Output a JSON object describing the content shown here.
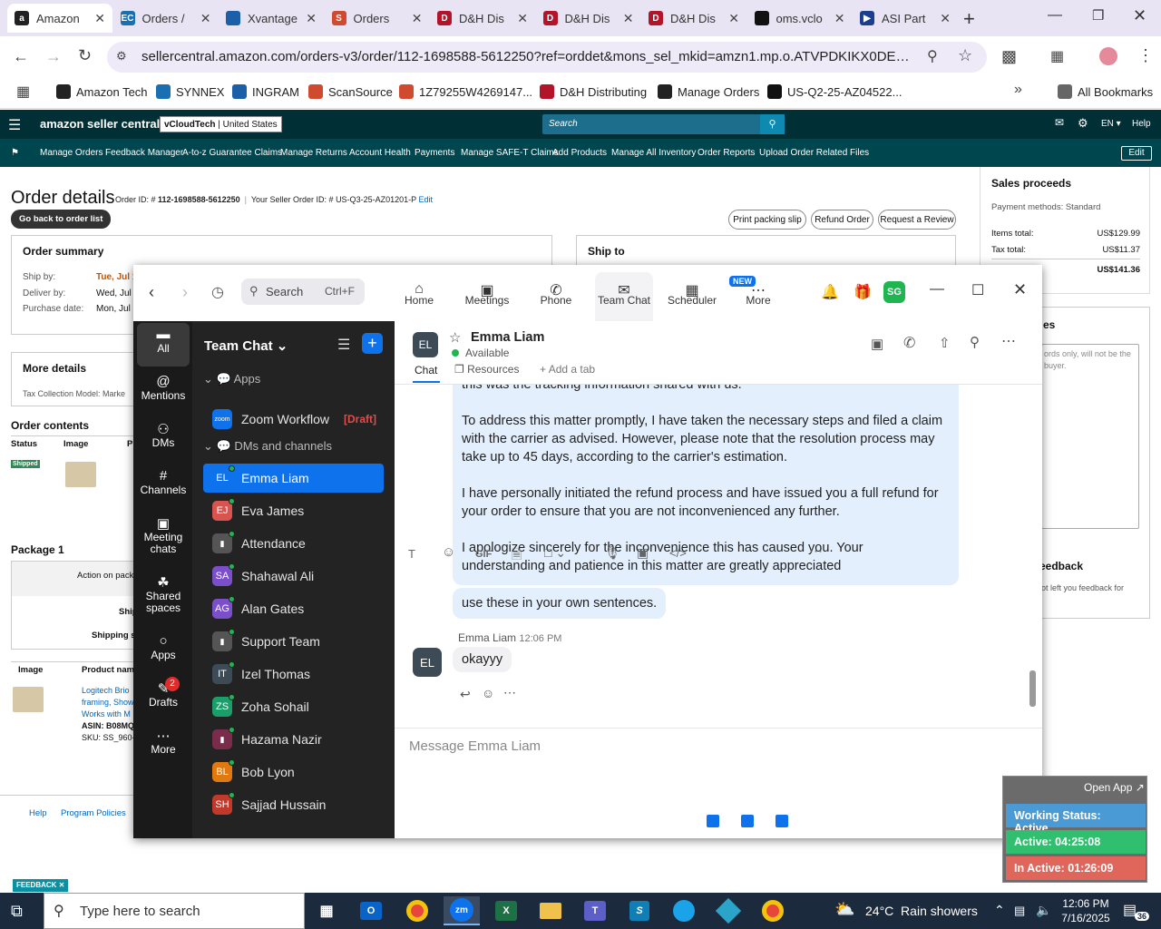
{
  "browser": {
    "tabs": [
      {
        "label": "Amazon",
        "active": true,
        "icon": "amazon-icon"
      },
      {
        "label": "Orders /",
        "icon": "sc-icon"
      },
      {
        "label": "Xvantage",
        "icon": "ingram-icon"
      },
      {
        "label": "Orders",
        "icon": "scansource-icon"
      },
      {
        "label": "D&H Dis",
        "icon": "dh-icon"
      },
      {
        "label": "D&H Dis",
        "icon": "dh-icon"
      },
      {
        "label": "D&H Dis",
        "icon": "dh-icon"
      },
      {
        "label": "oms.vclo",
        "icon": "oms-icon"
      },
      {
        "label": "ASI Part",
        "icon": "asi-icon"
      }
    ],
    "url": "sellercentral.amazon.com/orders-v3/order/112-1698588-5612250?ref=orddet&mons_sel_mkid=amzn1.mp.o.ATVPDKIKX0DER&mons_sel...",
    "bookmarks": [
      "Amazon Tech",
      "SYNNEX",
      "INGRAM",
      "ScanSource",
      "1Z79255W4269147...",
      "D&H Distributing",
      "Manage Orders",
      "US-Q2-25-AZ04522..."
    ],
    "all_bookmarks": "All Bookmarks"
  },
  "seller": {
    "logo": "amazon seller central",
    "account": "vCloudTech",
    "marketplace": "United States",
    "search_placeholder": "Search",
    "lang": "EN",
    "help": "Help",
    "nav": [
      "Manage Orders",
      "Feedback Manager",
      "A-to-z Guarantee Claims",
      "Manage Returns",
      "Account Health",
      "Payments",
      "Manage SAFE-T Claims",
      "Add Products",
      "Manage All Inventory",
      "Order Reports",
      "Upload Order Related Files"
    ],
    "edit": "Edit",
    "page_title": "Order details",
    "order_id_label": "Order ID: #",
    "order_id": "112-1698588-5612250",
    "seller_order_label": "Your Seller Order ID: #",
    "seller_order_id": "US-Q3-25-AZ01201-P",
    "seller_order_edit": "Edit",
    "back_btn": "Go back to order list",
    "print_btn": "Print packing slip",
    "refund_btn": "Refund Order",
    "review_btn": "Request a Review",
    "summary_title": "Order summary",
    "ship_by_label": "Ship by:",
    "ship_by": "Tue, Jul 1",
    "deliver_by_label": "Deliver by:",
    "deliver_by": "Wed, Jul 1",
    "purchase_label": "Purchase date:",
    "purchase": "Mon, Jul 1",
    "ship_to": "Ship to",
    "more_details": "More details",
    "tax_model": "Tax Collection Model: Marke",
    "contents": "Order contents",
    "col_status": "Status",
    "col_image": "Image",
    "col_p": "Pr",
    "status_badge": "Shipped",
    "package": "Package 1",
    "action": "Action on pack",
    "ship_short": "Ship",
    "shipping_short": "Shipping s",
    "pcol_image": "Image",
    "pcol_product": "Product nam",
    "product_line1": "Logitech Brio",
    "product_line2": "framing, Show",
    "product_line3": "Works with M",
    "asin": "ASIN: B08MQ",
    "sku": "SKU: SS_960-",
    "footer_help": "Help",
    "footer_policies": "Program Policies",
    "sales_proceeds": "Sales proceeds",
    "payment_methods": "Payment methods: Standard",
    "items_total_label": "Items total:",
    "items_total": "US$129.99",
    "tax_total_label": "Tax total:",
    "tax_total": "US$11.37",
    "grand_total": "US$141.36",
    "notes_title": "es",
    "notes_hint": "ords only, will not be the buyer.",
    "feedback_title": "eedback",
    "feedback_hint": "ot left you feedback for",
    "feedback_tag": "FEEDBACK"
  },
  "zoom": {
    "search": "Search",
    "search_shortcut": "Ctrl+F",
    "tabs": [
      "Home",
      "Meetings",
      "Phone",
      "Team Chat",
      "Scheduler",
      "More"
    ],
    "new_badge": "NEW",
    "avatar": "SG",
    "rail": [
      "All",
      "Mentions",
      "DMs",
      "Channels",
      "Meeting chats",
      "Shared spaces",
      "Apps",
      "Drafts",
      "More"
    ],
    "drafts_count": "2",
    "list_title": "Team Chat",
    "apps_label": "Apps",
    "zoom_workflow": "Zoom Workflow",
    "draft_tag": "[Draft]",
    "dms_label": "DMs and channels",
    "contacts": [
      {
        "name": "Emma Liam",
        "initials": "EL",
        "color": "#0e72ed",
        "selected": true
      },
      {
        "name": "Eva James",
        "initials": "EJ",
        "color": "#d9534f"
      },
      {
        "name": "Attendance",
        "initials": "",
        "color": "#555"
      },
      {
        "name": "Shahawal Ali",
        "initials": "SA",
        "color": "#7b4fc9"
      },
      {
        "name": "Alan Gates",
        "initials": "AG",
        "color": "#7b4fc9"
      },
      {
        "name": "Support Team",
        "initials": "",
        "color": "#555"
      },
      {
        "name": "Izel Thomas",
        "initials": "IT",
        "color": "#3d4b57"
      },
      {
        "name": "Zoha Sohail",
        "initials": "ZS",
        "color": "#1a9f6a"
      },
      {
        "name": "Hazama Nazir",
        "initials": "",
        "color": "#7a2d4a"
      },
      {
        "name": "Bob Lyon",
        "initials": "BL",
        "color": "#e07a10"
      },
      {
        "name": "Sajjad Hussain",
        "initials": "SH",
        "color": "#c0392b"
      }
    ],
    "chat_name": "Emma Liam",
    "chat_initials": "EL",
    "chat_status": "Available",
    "chat_tab": "Chat",
    "resources_tab": "Resources",
    "add_tab": "Add a tab",
    "msg_cut": "this was the tracking information shared with us.",
    "msg_p1": "To address this matter promptly, I have taken the necessary steps and filed a claim with the carrier as advised. However, please note that the resolution process may take up to 45 days, according to the carrier's estimation.",
    "msg_p2": "I have personally initiated the refund process and have issued you a full refund for your order to ensure that you are not inconvenienced any further.",
    "msg_p3": "I apologize sincerely for the inconvenience this has caused you. Your understanding and patience in this matter are greatly appreciated",
    "msg_short": "use these in your own sentences.",
    "reply_sender": "Emma Liam",
    "reply_time": "12:06 PM",
    "reply_text": "okayyy",
    "composer_placeholder": "Message Emma Liam"
  },
  "widget": {
    "open_app": "Open App ↗",
    "working": "Working Status: Active",
    "active": "Active: 04:25:08",
    "inactive": "In Active: 01:26:09"
  },
  "taskbar": {
    "search_placeholder": "Type here to search",
    "weather": "24°C  Rain showers",
    "time": "12:06 PM",
    "date": "7/16/2025",
    "notif_count": "36"
  }
}
